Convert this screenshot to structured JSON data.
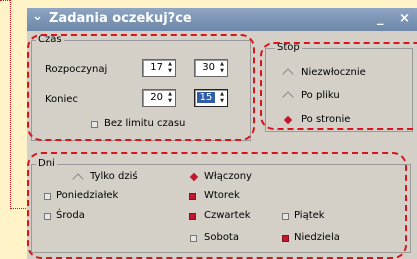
{
  "window": {
    "title": "Zadania oczekuj?ce",
    "minimize_glyph": "_",
    "close_glyph": "×"
  },
  "time_group": {
    "title": "Czas",
    "start_label": "Rozpoczynaj",
    "end_label": "Koniec",
    "start_hour": "17",
    "start_minute": "30",
    "end_hour": "20",
    "end_minute": "15",
    "no_limit_label": "Bez limitu czasu",
    "no_limit_checked": false
  },
  "stop_group": {
    "title": "Stop",
    "options": [
      "Niezwłocznie",
      "Po pliku",
      "Po stronie"
    ],
    "selected": "Po stronie"
  },
  "days_group": {
    "title": "Dni",
    "today_only_label": "Tylko dziś",
    "enabled_label": "Włączony",
    "selected_mode": "Włączony",
    "days": [
      {
        "label": "Poniedziałek",
        "checked": false
      },
      {
        "label": "Wtorek",
        "checked": true
      },
      {
        "label": "Środa",
        "checked": false
      },
      {
        "label": "Czwartek",
        "checked": true
      },
      {
        "label": "Piątek",
        "checked": false
      },
      {
        "label": "Sobota",
        "checked": false
      },
      {
        "label": "Niedziela",
        "checked": true
      }
    ]
  },
  "colors": {
    "annotation": "#d8141c",
    "checked": "#c0182e",
    "background": "#fff3c7",
    "window": "#d4d0c8"
  }
}
